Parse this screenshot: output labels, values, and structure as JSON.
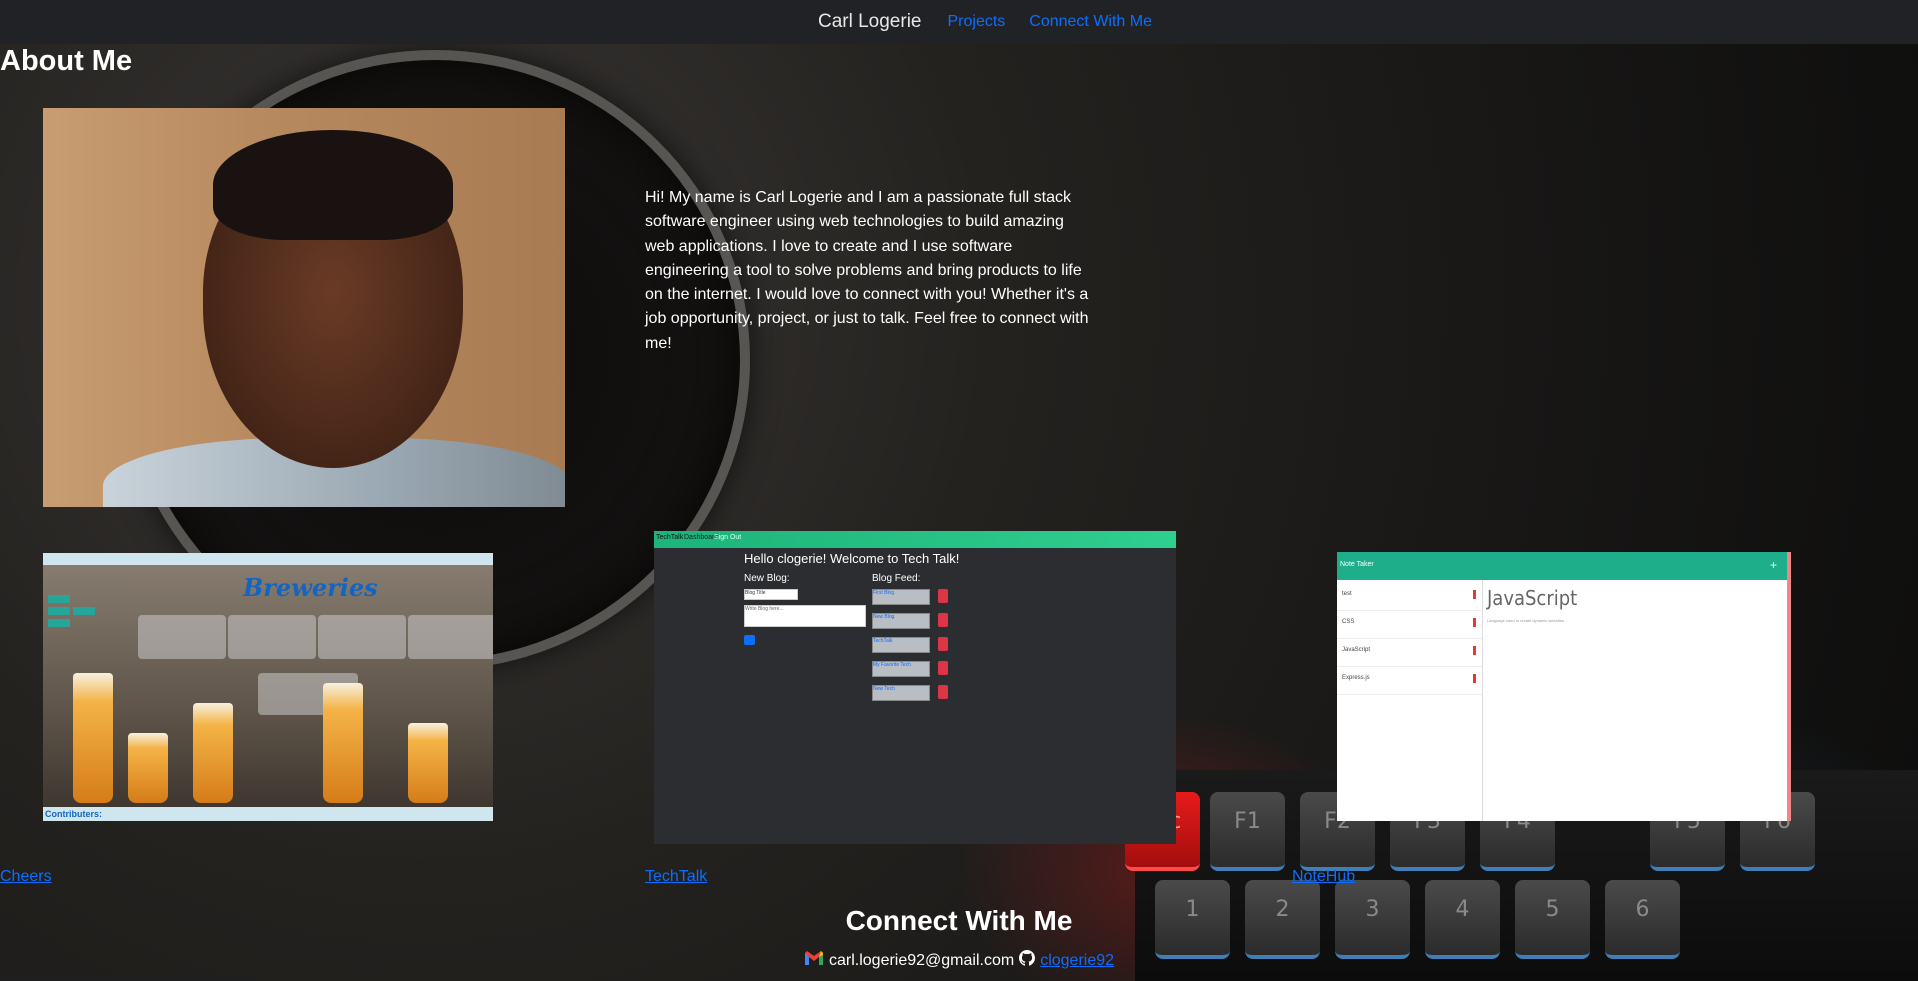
{
  "navbar": {
    "brand": "Carl Logerie",
    "links": [
      "Projects",
      "Connect With Me"
    ]
  },
  "about": {
    "heading": "About Me",
    "bio": "Hi! My name is Carl Logerie and I am a passionate full stack software engineer using web technologies to build amazing web applications. I love to create and I use software engineering a tool to solve problems and bring products to life on the internet. I would love to connect with you! Whether it's a job opportunity, project, or just to talk. Feel free to connect with me!"
  },
  "projects": [
    {
      "name": "Cheers",
      "screenshot": {
        "title": "Breweries",
        "footer": "Contributers:"
      }
    },
    {
      "name": "TechTalk",
      "screenshot": {
        "nav": [
          "TechTalk",
          "Dashboard",
          "Sign Out"
        ],
        "heading": "Hello clogerie! Welcome to Tech Talk!",
        "new_blog": "New Blog:",
        "blog_feed": "Blog Feed:",
        "input_value": "Blog Title",
        "textarea_placeholder": "Write Blog here...",
        "feed": [
          "First Blog",
          "New Blog",
          "TechTalk",
          "My Favorite Tech",
          "New Tech"
        ]
      }
    },
    {
      "name": "NoteHub",
      "screenshot": {
        "header": "Note Taker",
        "notes": [
          "test",
          "CSS",
          "JavaScript",
          "Express.js"
        ],
        "active_title": "JavaScript",
        "active_body": "Language used to create dynamic websites"
      }
    }
  ],
  "connect": {
    "heading": "Connect With Me",
    "email": "carl.logerie92@gmail.com",
    "github": "clogerie92"
  },
  "icons": {
    "email": "gmail-icon",
    "github": "github-icon"
  }
}
